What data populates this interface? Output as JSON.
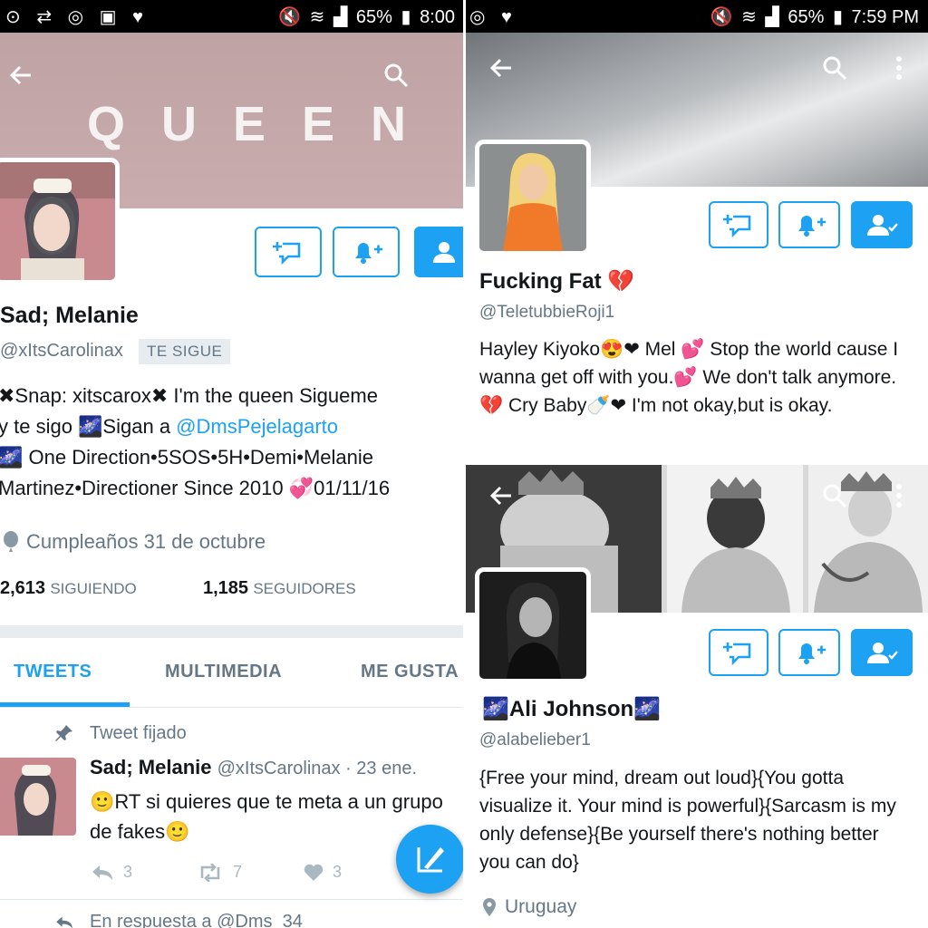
{
  "left": {
    "status": {
      "left_icons": "⊙ ⇄ ◎ ▣ ♥",
      "battery": "65%",
      "time": "8:00"
    },
    "banner_text": "QUEEN",
    "colors": {
      "banner": "#c4a8a8",
      "accent": "#1da1f2"
    },
    "profile": {
      "name": "Sad; Melanie",
      "handle": "@xItsCarolinax",
      "follows_badge": "TE SIGUE",
      "bio_line1": "✖Snap: xitscarox✖  I'm the queen  Sigueme",
      "bio_line2_a": "y te sigo  🌌Sigan a ",
      "bio_line2_link": "@DmsPejelagarto",
      "bio_line3": "🌌 One Direction•5SOS•5H•Demi•Melanie",
      "bio_line4": "Martinez•Directioner Since 2010  💞01/11/16",
      "birthday": "Cumpleaños 31 de octubre",
      "following_count": "2,613",
      "following_label": "SIGUIENDO",
      "followers_count": "1,185",
      "followers_label": "SEGUIDORES"
    },
    "tabs": [
      "TWEETS",
      "MULTIMEDIA",
      "ME GUSTA"
    ],
    "pinned_label": "Tweet fijado",
    "tweet": {
      "name": "Sad; Melanie",
      "handle_date": "@xItsCarolinax · 23 ene.",
      "text": "🙂RT si quieres que te meta a un grupo de fakes🙂",
      "replies": "3",
      "retweets": "7",
      "likes": "3"
    },
    "next_tweet_context": "En respuesta a @Dms_34"
  },
  "top_right": {
    "status": {
      "left_icons": "◎ ♥",
      "battery": "65%",
      "time": "7:59 PM"
    },
    "profile": {
      "name": "Fucking Fat 💔",
      "handle": "@TeletubbieRoji1",
      "bio": "Hayley Kiyoko😍❤ Mel 💕 Stop the world cause I wanna get off with you.💕 We don't talk anymore.💔 Cry Baby🍼❤ I'm not okay,but is okay."
    }
  },
  "bottom_right": {
    "profile": {
      "name": "🌌Ali Johnson🌌",
      "handle": "@alabelieber1",
      "bio": "{Free your mind, dream out loud}{You gotta visualize it. Your mind is powerful}{Sarcasm is my only defense}{Be yourself there's nothing better you can do}",
      "location": "Uruguay"
    }
  }
}
